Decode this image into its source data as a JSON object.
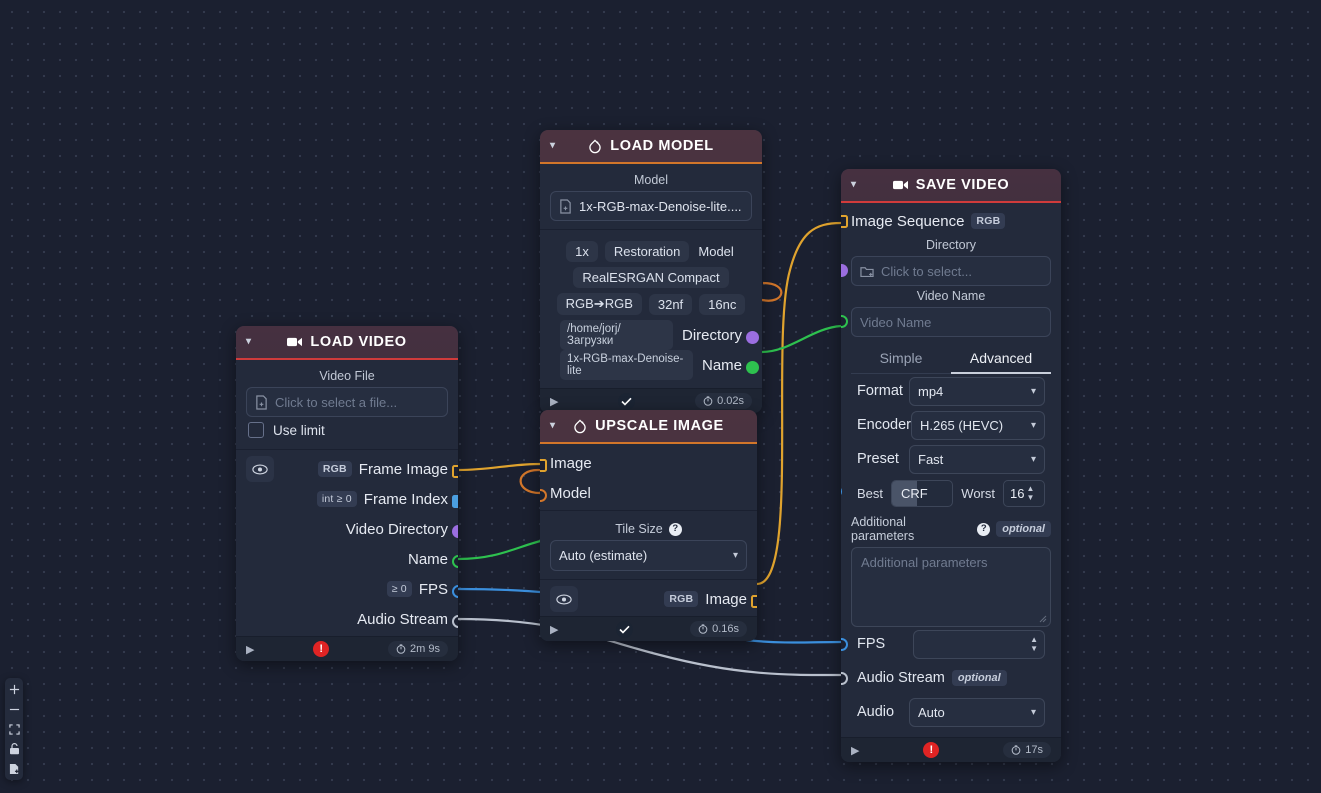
{
  "app": {
    "background": "#1b2030",
    "accent_orange": "#d2762a",
    "accent_red": "#d03b3b"
  },
  "toolbar": {
    "items": [
      {
        "name": "zoom-in-icon",
        "label": "+"
      },
      {
        "name": "zoom-out-icon",
        "label": "−"
      },
      {
        "name": "fit-view-icon",
        "label": ""
      },
      {
        "name": "lock-icon",
        "label": ""
      },
      {
        "name": "add-node-icon",
        "label": ""
      }
    ]
  },
  "nodes": {
    "load_video": {
      "title": "LOAD VIDEO",
      "icon": "video-camera-icon",
      "fields": {
        "video_file_label": "Video File",
        "video_file_placeholder": "Click to select a file...",
        "use_limit_label": "Use limit"
      },
      "outputs": [
        {
          "label": "Frame Image",
          "tag": "RGB",
          "socket": "square-orange",
          "has_eye": true
        },
        {
          "label": "Frame Index",
          "tag": "int ≥ 0",
          "socket": "square-blue-filled"
        },
        {
          "label": "Video Directory",
          "tag": "",
          "socket": "circle-purple"
        },
        {
          "label": "Name",
          "tag": "",
          "socket": "circle-green-hollow"
        },
        {
          "label": "FPS",
          "tag": "≥ 0",
          "socket": "circle-blue-hollow"
        },
        {
          "label": "Audio Stream",
          "tag": "",
          "socket": "circle-gray-hollow"
        }
      ],
      "footer": {
        "play": "▶",
        "status": "error",
        "time": "2m 9s"
      }
    },
    "load_model": {
      "title": "LOAD MODEL",
      "icon": "pytorch-icon",
      "fields": {
        "model_label": "Model",
        "model_value": "1x-RGB-max-Denoise-lite...."
      },
      "tags_row1": [
        "1x",
        "Restoration",
        "Model"
      ],
      "tags_row2": [
        "RealESRGAN Compact"
      ],
      "tags_row3": [
        "RGB➔RGB",
        "32nf",
        "16nc"
      ],
      "outputs": [
        {
          "value": "/home/jorj/Загрузки",
          "label": "Directory",
          "socket": "circle-purple"
        },
        {
          "value": "1x-RGB-max-Denoise-lite",
          "label": "Name",
          "socket": "circle-green"
        }
      ],
      "model_socket": "circle-orange-hollow",
      "footer": {
        "play": "▶",
        "status": "check",
        "time": "0.02s"
      }
    },
    "upscale_image": {
      "title": "UPSCALE IMAGE",
      "icon": "pytorch-icon",
      "inputs": [
        {
          "label": "Image",
          "socket": "square-orange"
        },
        {
          "label": "Model",
          "socket": "circle-orange-hollow"
        }
      ],
      "fields": {
        "tile_size_label": "Tile Size",
        "tile_size_value": "Auto (estimate)"
      },
      "outputs": [
        {
          "label": "Image",
          "tag": "RGB",
          "socket": "square-orange",
          "has_eye": true
        }
      ],
      "footer": {
        "play": "▶",
        "status": "check",
        "time": "0.16s"
      }
    },
    "save_video": {
      "title": "SAVE VIDEO",
      "icon": "video-camera-icon",
      "image_sequence": {
        "label": "Image Sequence",
        "tag": "RGB",
        "socket": "square-orange"
      },
      "directory": {
        "label": "Directory",
        "placeholder": "Click to select...",
        "socket": "circle-purple"
      },
      "video_name": {
        "label": "Video Name",
        "placeholder": "Video Name",
        "socket": "circle-green-hollow"
      },
      "tabs": [
        {
          "label": "Simple",
          "active": false
        },
        {
          "label": "Advanced",
          "active": true
        }
      ],
      "params": [
        {
          "label": "Format",
          "value": "mp4",
          "type": "select"
        },
        {
          "label": "Encoder",
          "value": "H.265 (HEVC)",
          "type": "select"
        },
        {
          "label": "Preset",
          "value": "Fast",
          "type": "select"
        }
      ],
      "crf": {
        "best_label": "Best",
        "slider_caption": "CRF",
        "worst_label": "Worst",
        "value": "16",
        "fill_percent": 16,
        "socket": "circle-blue-filled"
      },
      "additional": {
        "label": "Additional parameters",
        "optional": "optional",
        "placeholder": "Additional parameters"
      },
      "fps": {
        "label": "FPS",
        "value": "",
        "socket": "circle-blue-hollow"
      },
      "audio_stream": {
        "label": "Audio Stream",
        "optional": "optional",
        "socket": "circle-gray-hollow"
      },
      "audio": {
        "label": "Audio",
        "value": "Auto",
        "type": "select"
      },
      "footer": {
        "play": "▶",
        "status": "error",
        "time": "17s"
      }
    }
  },
  "wires": [
    {
      "name": "frame-image-to-upscale-image",
      "color": "#e0a32e"
    },
    {
      "name": "model-to-upscale-model",
      "color": "#d2762a"
    },
    {
      "name": "upscale-image-to-save-image-sequence",
      "color": "#e0a32e"
    },
    {
      "name": "name-to-save-video-name",
      "color": "#2ec14f"
    },
    {
      "name": "fps-to-save-fps",
      "color": "#3b8fdd"
    },
    {
      "name": "audio-stream-to-save-audio-stream",
      "color": "#b9c0cd"
    }
  ]
}
